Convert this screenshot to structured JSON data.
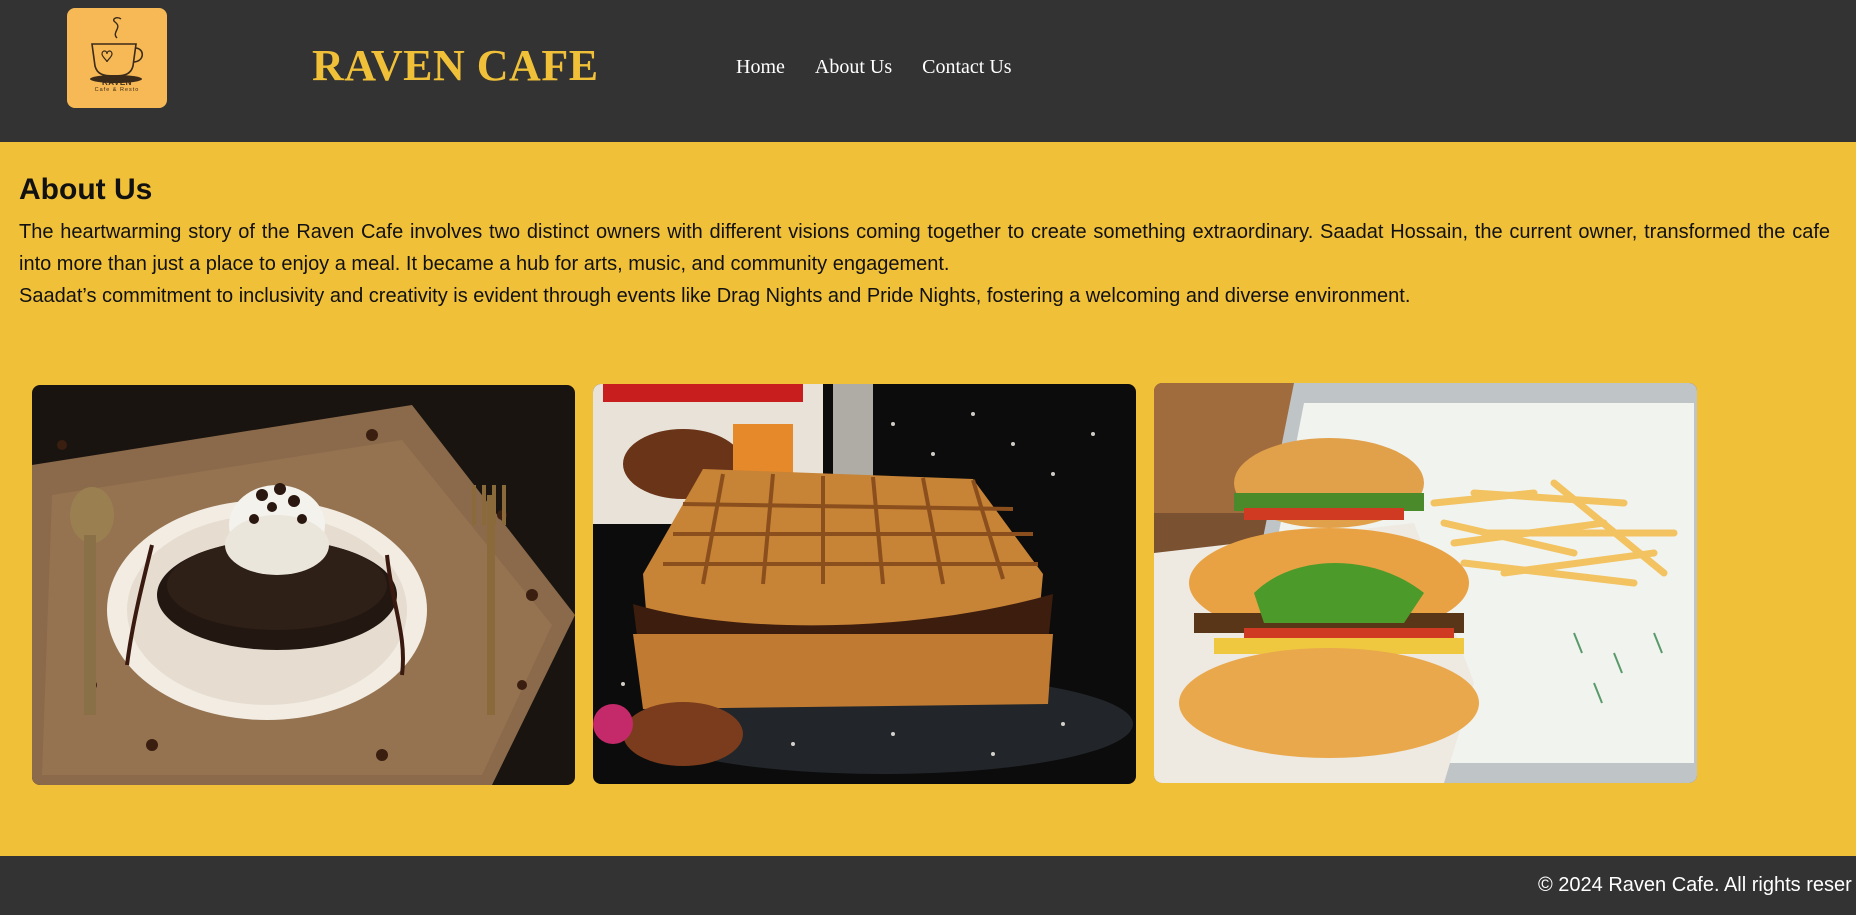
{
  "header": {
    "logo": {
      "icon": "coffee-cup-icon",
      "word": "RAVEN",
      "tagline": "Cafe & Resto"
    },
    "brand": "RAVEN CAFE",
    "nav": [
      {
        "label": "Home"
      },
      {
        "label": "About Us"
      },
      {
        "label": "Contact Us"
      }
    ]
  },
  "main": {
    "title": "About Us",
    "paragraphs": [
      "The heartwarming story of the Raven Cafe involves two distinct owners with different visions coming together to create something extraordinary. Saadat Hossain, the current owner, transformed the cafe into more than just a place to enjoy a meal. It became a hub for arts, music, and community engagement.",
      "Saadat’s commitment to inclusivity and creativity is evident through events like Drag Nights and Pride Nights, fostering a welcoming and diverse environment."
    ]
  },
  "footer": {
    "copyright": "© 2024 Raven Cafe. All rights reser"
  },
  "colors": {
    "header_bg": "#333333",
    "accent": "#f0c038",
    "logo_bg": "#f7b955",
    "text": "#111111"
  }
}
